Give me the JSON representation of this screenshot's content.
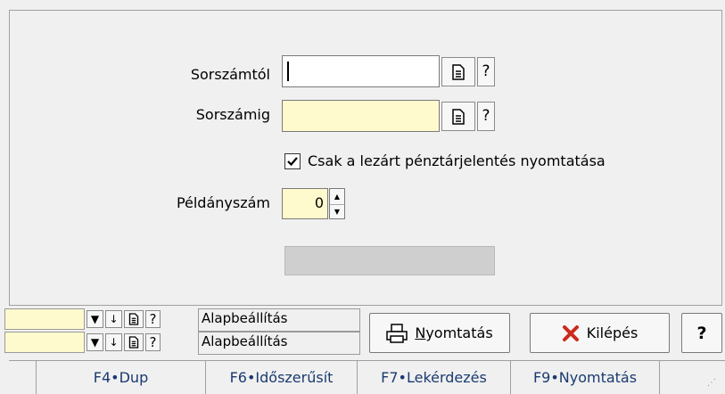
{
  "form": {
    "from_label": "Sorszámtól",
    "from_value": "",
    "to_label": "Sorszámig",
    "to_value": "",
    "help": "?",
    "checkbox_label": "Csak a lezárt pénztárjelentés nyomtatása",
    "checkbox_checked": true,
    "copies_label": "Példányszám",
    "copies_value": "0"
  },
  "presets": [
    {
      "label": "Alapbeállítás"
    },
    {
      "label": "Alapbeállítás"
    }
  ],
  "buttons": {
    "print_first": "N",
    "print_rest": "yomtatás",
    "exit": "Kilépés",
    "help": "?"
  },
  "fkeys": [
    "F4•Dup",
    "F6•Időszerűsít",
    "F7•Lekérdezés",
    "F9•Nyomtatás"
  ],
  "colors": {
    "field_yellow": "#fffacd",
    "exit_icon": "#cc2a1a"
  }
}
